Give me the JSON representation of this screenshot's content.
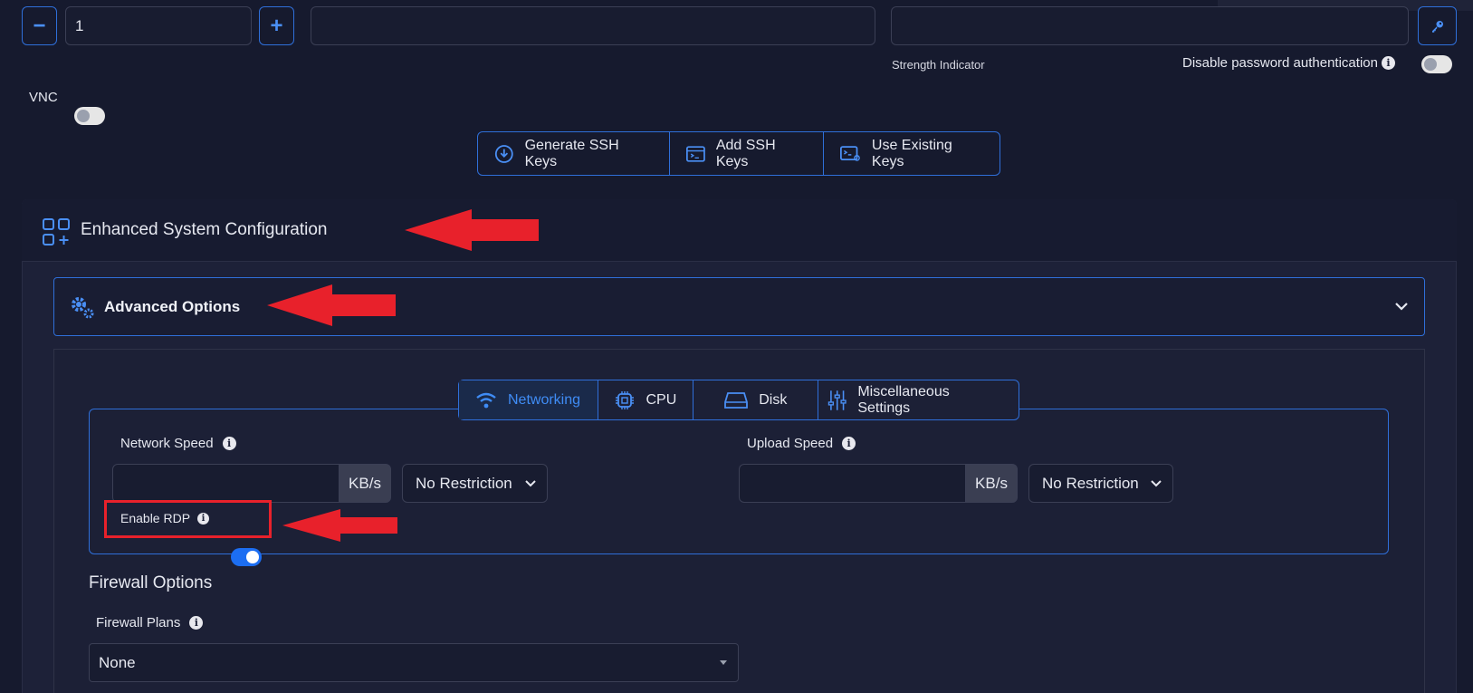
{
  "quantity": {
    "value": "1",
    "minus": "−",
    "plus": "+"
  },
  "password": {
    "strength_label": "Strength Indicator",
    "disable_label": "Disable password authentication"
  },
  "vnc": {
    "label": "VNC"
  },
  "ssh": {
    "generate": "Generate SSH Keys",
    "add": "Add SSH Keys",
    "existing": "Use Existing Keys"
  },
  "section": {
    "title": "Enhanced System Configuration"
  },
  "advanced": {
    "title": "Advanced Options"
  },
  "tabs": [
    {
      "label": "Networking"
    },
    {
      "label": "CPU"
    },
    {
      "label": "Disk"
    },
    {
      "label": "Miscellaneous Settings"
    }
  ],
  "network": {
    "speed_label": "Network Speed",
    "upload_label": "Upload Speed",
    "unit": "KB/s",
    "restriction": "No Restriction",
    "rdp_label": "Enable RDP"
  },
  "firewall": {
    "title": "Firewall Options",
    "plans_label": "Firewall Plans",
    "plans_value": "None"
  },
  "colors": {
    "accent": "#2f6fd9",
    "active_tab": "#3f8cf5",
    "annotation": "#e8212b",
    "toggle_on": "#1c6ef2"
  }
}
